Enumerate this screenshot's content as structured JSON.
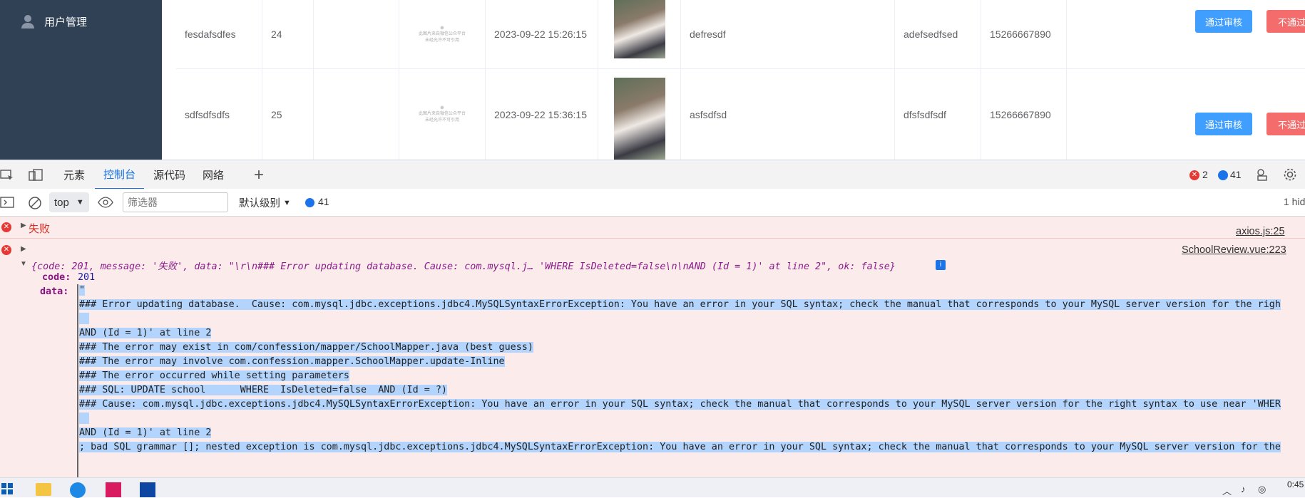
{
  "sidebar": {
    "menu_label": "用户管理"
  },
  "rows": [
    {
      "name": "fesdafsdfes",
      "num": "24",
      "placeholder_lines": [
        "此图片来自微信公众平台",
        "未经允许不可引用"
      ],
      "time": "2023-09-22 15:26:15",
      "c1": "defresdf",
      "c2": "adefsedfsed",
      "phone": "15266667890",
      "approve": "通过审核",
      "reject": "不通过审核"
    },
    {
      "name": "sdfsdfsdfs",
      "num": "25",
      "placeholder_lines": [
        "此图片来自微信公众平台",
        "未经允许不可引用"
      ],
      "time": "2023-09-22 15:36:15",
      "c1": "asfsdfsd",
      "c2": "dfsfsdfsdf",
      "phone": "15266667890",
      "approve": "通过审核",
      "reject": "不通过审核"
    }
  ],
  "devtools": {
    "tabs": [
      "元素",
      "控制台",
      "源代码",
      "网络"
    ],
    "error_count": "2",
    "message_count": "41",
    "context": "top",
    "filter_placeholder": "筛选器",
    "level": "默认级别",
    "toolbar_msg_count": "41",
    "hidden": "1 hid"
  },
  "console": {
    "first_error": "失败",
    "first_src": "axios.js:25",
    "second_src": "SchoolReview.vue:223",
    "summary": "{code: 201, message: '失败', data: \"\\r\\n### Error updating database.  Cause: com.mysql.j… 'WHERE  IsDeleted=false\\n\\nAND (Id = 1)' at line 2\", ok: false}",
    "code_key": "code:",
    "code_val": "201",
    "data_key": "data:",
    "data_lines": [
      "\"",
      "### Error updating database.  Cause: com.mysql.jdbc.exceptions.jdbc4.MySQLSyntaxErrorException: You have an error in your SQL syntax; check the manual that corresponds to your MySQL server version for the righ",
      "",
      "AND (Id = 1)' at line 2",
      "### The error may exist in com/confession/mapper/SchoolMapper.java (best guess)",
      "### The error may involve com.confession.mapper.SchoolMapper.update-Inline",
      "### The error occurred while setting parameters",
      "### SQL: UPDATE school      WHERE  IsDeleted=false  AND (Id = ?)",
      "### Cause: com.mysql.jdbc.exceptions.jdbc4.MySQLSyntaxErrorException: You have an error in your SQL syntax; check the manual that corresponds to your MySQL server version for the right syntax to use near 'WHER",
      "",
      "AND (Id = 1)' at line 2",
      "; bad SQL grammar []; nested exception is com.mysql.jdbc.exceptions.jdbc4.MySQLSyntaxErrorException: You have an error in your SQL syntax; check the manual that corresponds to your MySQL server version for the"
    ]
  },
  "taskbar": {
    "time": "0:45"
  },
  "colors": {
    "sidebar": "#304156",
    "primary": "#409eff",
    "danger": "#f56c6c",
    "selection": "#b3d4fd",
    "error_bg": "#fcebeb"
  }
}
